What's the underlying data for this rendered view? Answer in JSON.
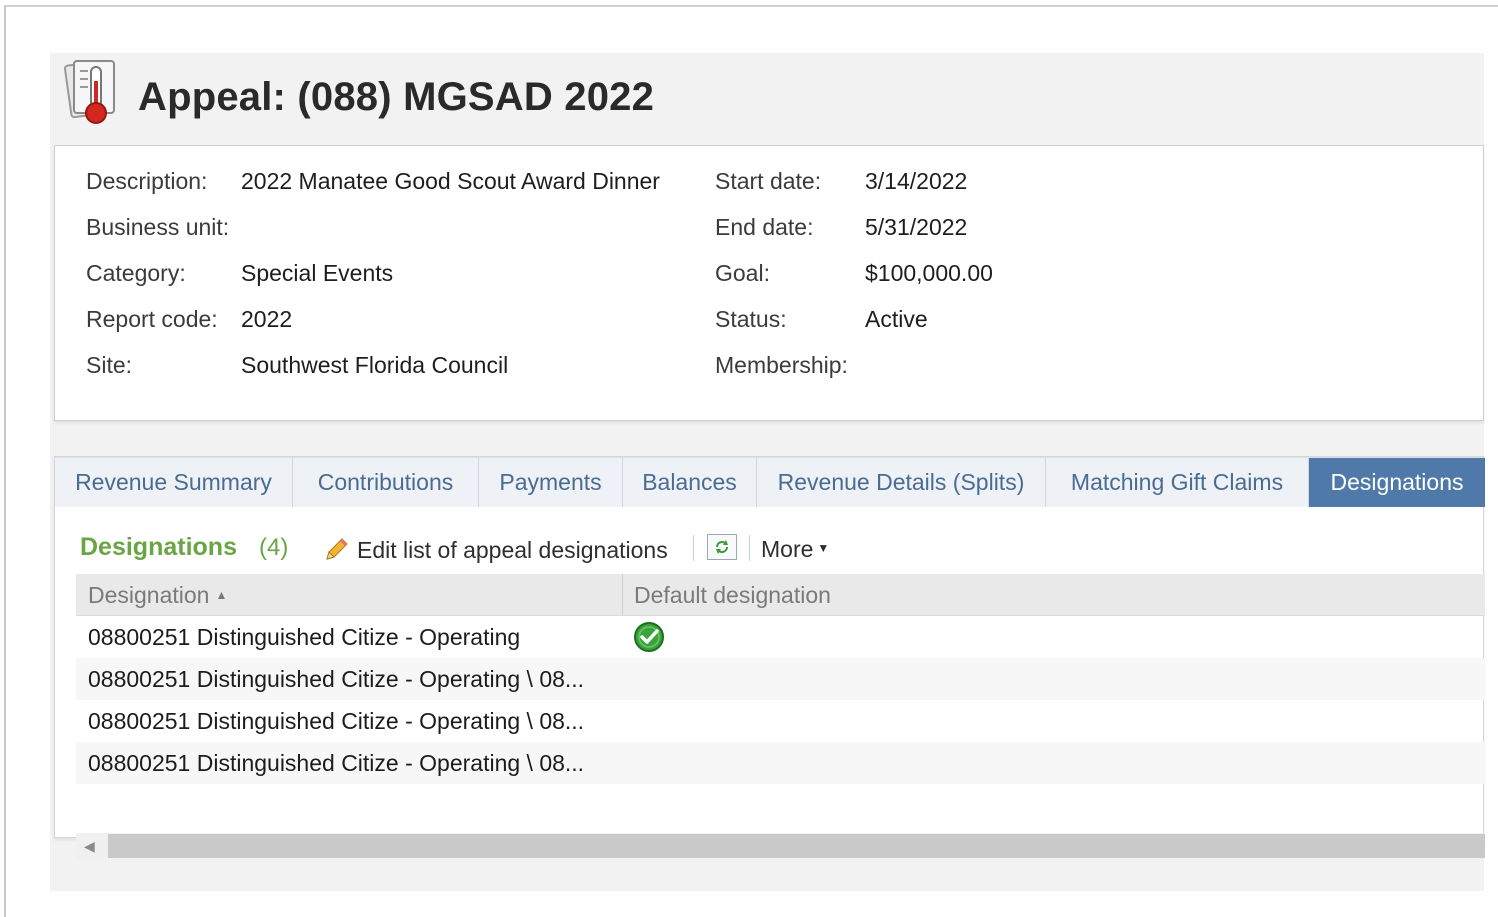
{
  "header": {
    "title": "Appeal: (088) MGSAD 2022",
    "icon": "thermometer-icon"
  },
  "summary": {
    "left": [
      {
        "label": "Description:",
        "value": "2022 Manatee Good Scout Award Dinner"
      },
      {
        "label": "Business unit:",
        "value": ""
      },
      {
        "label": "Category:",
        "value": "Special Events"
      },
      {
        "label": "Report code:",
        "value": "2022"
      },
      {
        "label": "Site:",
        "value": "Southwest Florida Council"
      }
    ],
    "right": [
      {
        "label": "Start date:",
        "value": "3/14/2022"
      },
      {
        "label": "End date:",
        "value": "5/31/2022"
      },
      {
        "label": "Goal:",
        "value": "$100,000.00"
      },
      {
        "label": "Status:",
        "value": "Active"
      },
      {
        "label": "Membership:",
        "value": ""
      }
    ]
  },
  "tabs": [
    {
      "label": "Revenue Summary",
      "active": false
    },
    {
      "label": "Contributions",
      "active": false
    },
    {
      "label": "Payments",
      "active": false
    },
    {
      "label": "Balances",
      "active": false
    },
    {
      "label": "Revenue Details (Splits)",
      "active": false
    },
    {
      "label": "Matching Gift Claims",
      "active": false
    },
    {
      "label": "Designations",
      "active": true
    }
  ],
  "designations": {
    "title": "Designations",
    "count": "(4)",
    "edit_label": "Edit list of appeal designations",
    "more_label": "More",
    "columns": [
      "Designation",
      "Default designation"
    ],
    "rows": [
      {
        "designation": "08800251 Distinguished Citize - Operating",
        "default": true
      },
      {
        "designation": "08800251 Distinguished Citize - Operating \\ 08...",
        "default": false
      },
      {
        "designation": "08800251 Distinguished Citize - Operating \\ 08...",
        "default": false
      },
      {
        "designation": "08800251 Distinguished Citize - Operating \\ 08...",
        "default": false
      }
    ]
  },
  "colors": {
    "active_tab": "#4f79a8",
    "tab_text": "#4a6c93",
    "section_title": "#6aa544",
    "check": "#3aa33a"
  }
}
